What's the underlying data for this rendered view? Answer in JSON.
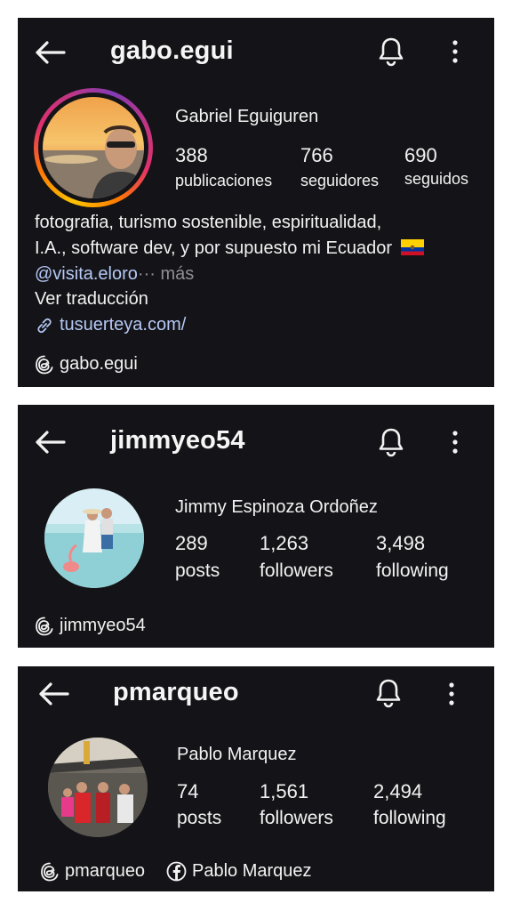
{
  "profiles": [
    {
      "username": "gabo.egui",
      "full_name": "Gabriel Eguiguren",
      "stats": [
        {
          "value": "388",
          "label": "publicaciones"
        },
        {
          "value": "766",
          "label": "seguidores"
        },
        {
          "value": "690",
          "label": "seguidos"
        }
      ],
      "bio_line1": "fotografia, turismo sostenible, espiritualidad,",
      "bio_line2": "I.A., software dev, y por supuesto mi Ecuador",
      "mention": "@visita.eloro",
      "ellipsis": "···",
      "more": "más",
      "translate": "Ver traducción",
      "link": "tusuerteya.com/",
      "threads": "gabo.egui",
      "story_ring": true
    },
    {
      "username": "jimmyeo54",
      "full_name": "Jimmy Espinoza Ordoñez",
      "stats": [
        {
          "value": "289",
          "label": "posts"
        },
        {
          "value": "1,263",
          "label": "followers"
        },
        {
          "value": "3,498",
          "label": "following"
        }
      ],
      "threads": "jimmyeo54"
    },
    {
      "username": "pmarqueo",
      "full_name": "Pablo Marquez",
      "stats": [
        {
          "value": "74",
          "label": "posts"
        },
        {
          "value": "1,561",
          "label": "followers"
        },
        {
          "value": "2,494",
          "label": "following"
        }
      ],
      "threads": "pmarqueo",
      "facebook": "Pablo Marquez"
    }
  ],
  "icons": {
    "back": "arrow-left-icon",
    "bell": "bell-icon",
    "more": "more-vertical-icon",
    "threads": "threads-icon",
    "link": "link-icon",
    "facebook": "facebook-icon",
    "flag": "ecuador-flag-icon"
  },
  "colors": {
    "panel_bg": "#141418",
    "text": "#f2f2f2",
    "mention": "#b5c8f5",
    "secondary": "#8e8e93"
  }
}
